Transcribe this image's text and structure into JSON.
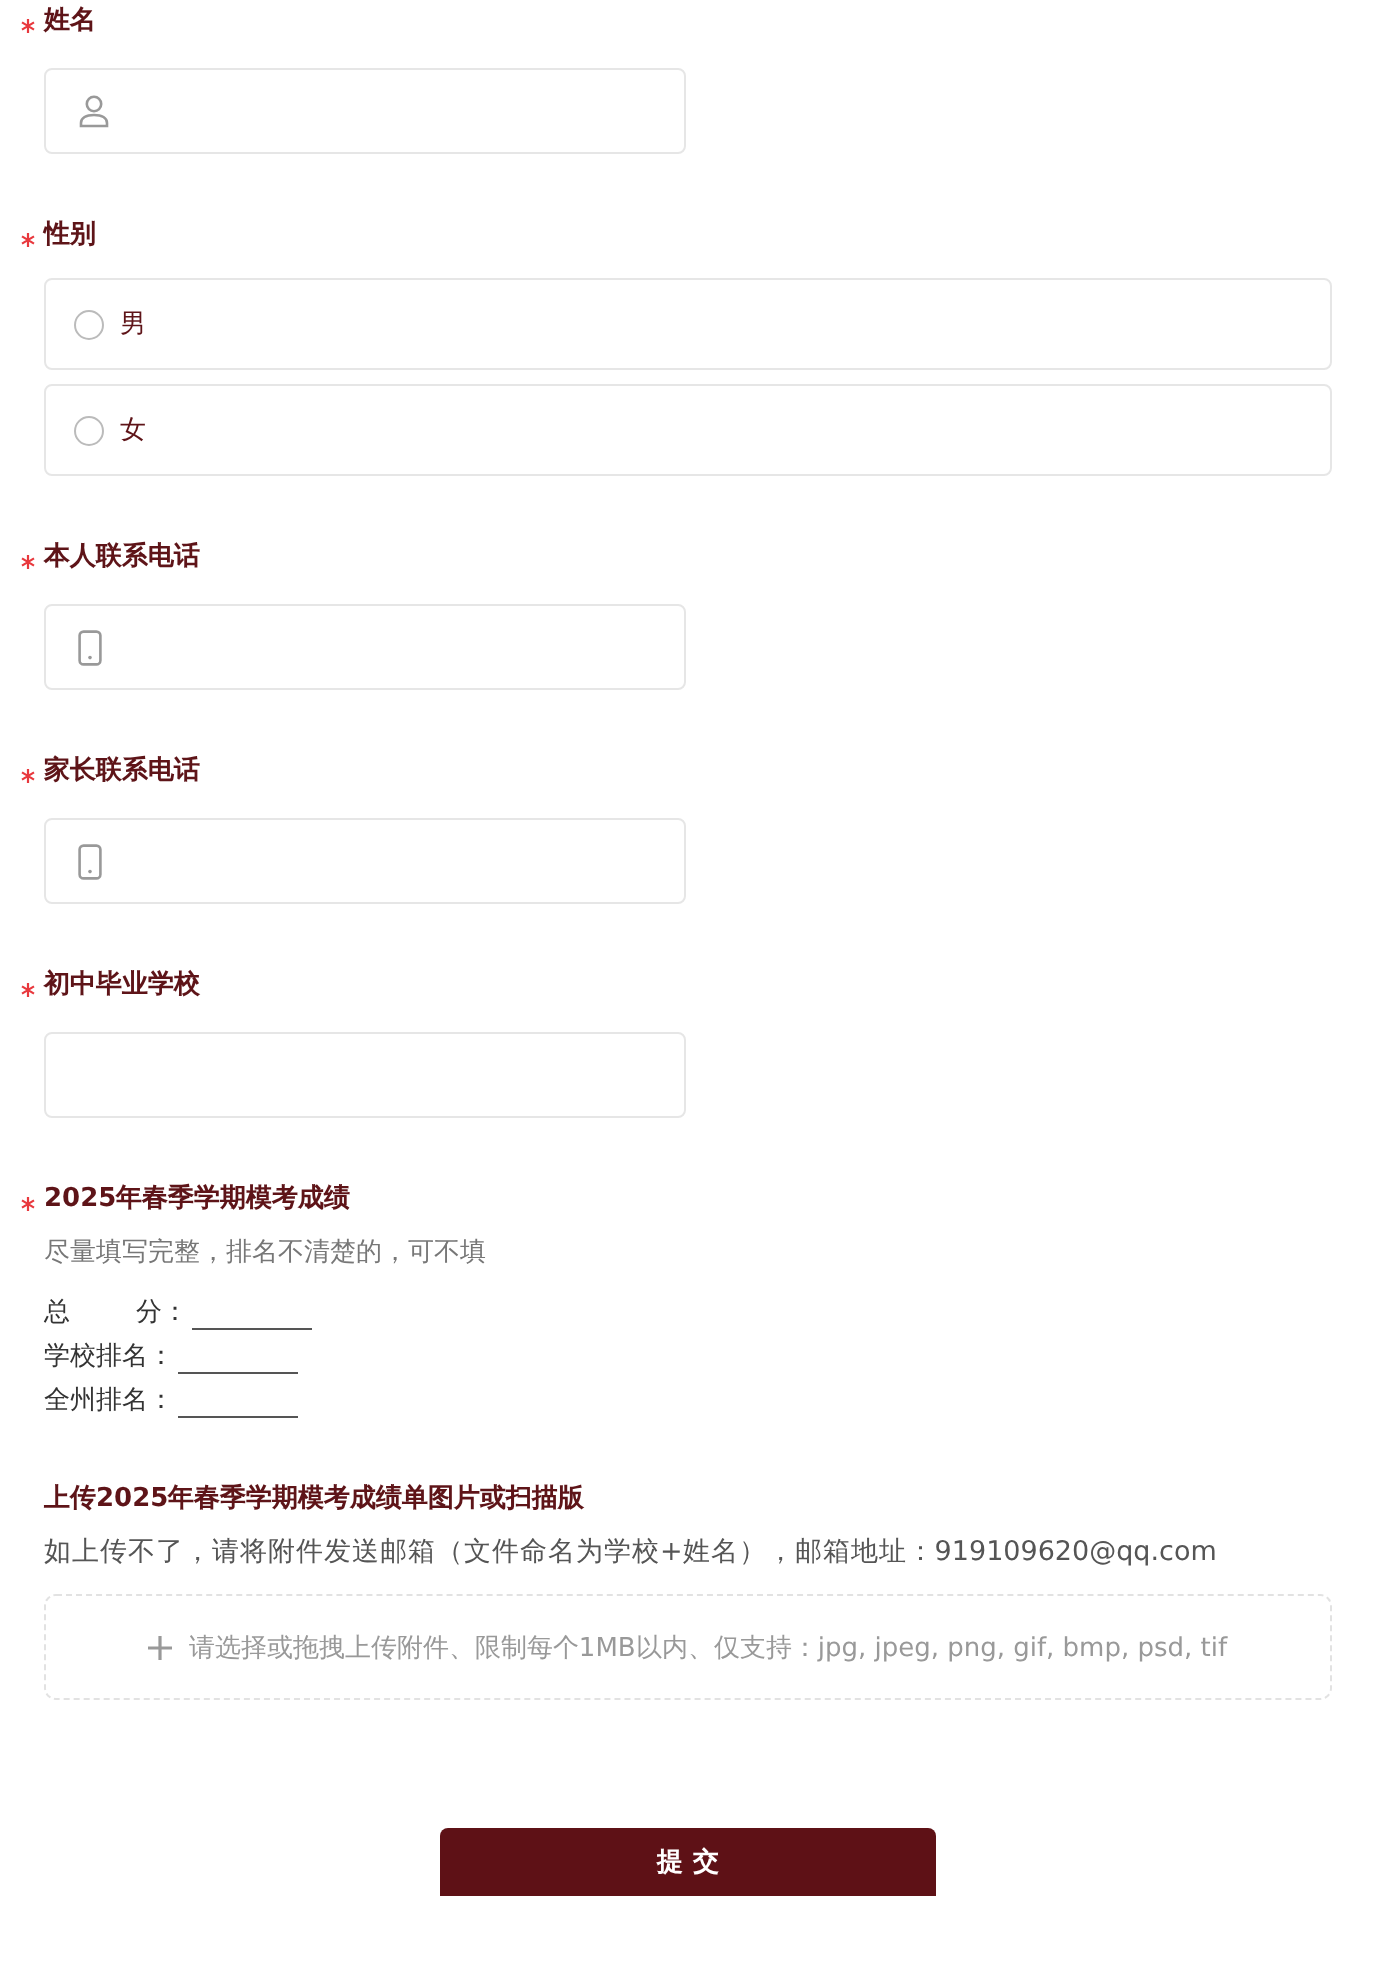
{
  "fields": [
    {
      "kind": "name",
      "label": "姓名",
      "required": true
    },
    {
      "kind": "radio",
      "label": "性别",
      "required": true,
      "options": [
        {
          "label": "男",
          "selected": false
        },
        {
          "label": "女",
          "selected": false
        }
      ]
    },
    {
      "kind": "phone",
      "label": "本人联系电话",
      "required": true
    },
    {
      "kind": "phone",
      "label": "家长联系电话",
      "required": true
    },
    {
      "kind": "plain",
      "label": "初中毕业学校",
      "required": true
    },
    {
      "kind": "scores",
      "label": "2025年春季学期模考成绩",
      "required": true,
      "hint": "尽量填写完整，排名不清楚的，可不填",
      "lines": [
        "总        分：",
        "学校排名：",
        "全州排名："
      ]
    },
    {
      "kind": "upload",
      "label": "上传2025年春季学期模考成绩单图片或扫描版",
      "required": false,
      "hint": "如上传不了，请将附件发送邮箱（文件命名为学校+姓名），邮箱地址：919109620@qq.com",
      "placeholder": "请选择或拖拽上传附件、限制每个1MB以内、仅支持：jpg, jpeg, png, gif, bmp, psd, tif"
    }
  ],
  "submit": "提 交"
}
